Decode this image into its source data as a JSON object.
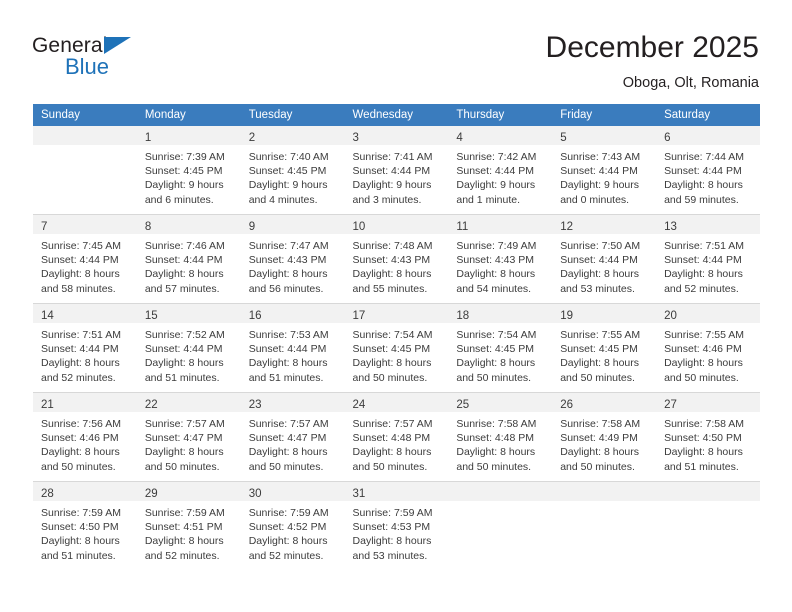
{
  "brand": {
    "name_top": "General",
    "name_bottom": "Blue",
    "accent_color": "#1e72b8"
  },
  "header": {
    "month_title": "December 2025",
    "location": "Oboga, Olt, Romania"
  },
  "calendar": {
    "header_color": "#3a7cbe",
    "datebar_color": "#f2f2f2",
    "weekday_headers": [
      "Sunday",
      "Monday",
      "Tuesday",
      "Wednesday",
      "Thursday",
      "Friday",
      "Saturday"
    ],
    "weeks": [
      [
        {
          "day": "",
          "sunrise": "",
          "sunset": "",
          "daylight_1": "",
          "daylight_2": ""
        },
        {
          "day": "1",
          "sunrise": "Sunrise: 7:39 AM",
          "sunset": "Sunset: 4:45 PM",
          "daylight_1": "Daylight: 9 hours",
          "daylight_2": "and 6 minutes."
        },
        {
          "day": "2",
          "sunrise": "Sunrise: 7:40 AM",
          "sunset": "Sunset: 4:45 PM",
          "daylight_1": "Daylight: 9 hours",
          "daylight_2": "and 4 minutes."
        },
        {
          "day": "3",
          "sunrise": "Sunrise: 7:41 AM",
          "sunset": "Sunset: 4:44 PM",
          "daylight_1": "Daylight: 9 hours",
          "daylight_2": "and 3 minutes."
        },
        {
          "day": "4",
          "sunrise": "Sunrise: 7:42 AM",
          "sunset": "Sunset: 4:44 PM",
          "daylight_1": "Daylight: 9 hours",
          "daylight_2": "and 1 minute."
        },
        {
          "day": "5",
          "sunrise": "Sunrise: 7:43 AM",
          "sunset": "Sunset: 4:44 PM",
          "daylight_1": "Daylight: 9 hours",
          "daylight_2": "and 0 minutes."
        },
        {
          "day": "6",
          "sunrise": "Sunrise: 7:44 AM",
          "sunset": "Sunset: 4:44 PM",
          "daylight_1": "Daylight: 8 hours",
          "daylight_2": "and 59 minutes."
        }
      ],
      [
        {
          "day": "7",
          "sunrise": "Sunrise: 7:45 AM",
          "sunset": "Sunset: 4:44 PM",
          "daylight_1": "Daylight: 8 hours",
          "daylight_2": "and 58 minutes."
        },
        {
          "day": "8",
          "sunrise": "Sunrise: 7:46 AM",
          "sunset": "Sunset: 4:44 PM",
          "daylight_1": "Daylight: 8 hours",
          "daylight_2": "and 57 minutes."
        },
        {
          "day": "9",
          "sunrise": "Sunrise: 7:47 AM",
          "sunset": "Sunset: 4:43 PM",
          "daylight_1": "Daylight: 8 hours",
          "daylight_2": "and 56 minutes."
        },
        {
          "day": "10",
          "sunrise": "Sunrise: 7:48 AM",
          "sunset": "Sunset: 4:43 PM",
          "daylight_1": "Daylight: 8 hours",
          "daylight_2": "and 55 minutes."
        },
        {
          "day": "11",
          "sunrise": "Sunrise: 7:49 AM",
          "sunset": "Sunset: 4:43 PM",
          "daylight_1": "Daylight: 8 hours",
          "daylight_2": "and 54 minutes."
        },
        {
          "day": "12",
          "sunrise": "Sunrise: 7:50 AM",
          "sunset": "Sunset: 4:44 PM",
          "daylight_1": "Daylight: 8 hours",
          "daylight_2": "and 53 minutes."
        },
        {
          "day": "13",
          "sunrise": "Sunrise: 7:51 AM",
          "sunset": "Sunset: 4:44 PM",
          "daylight_1": "Daylight: 8 hours",
          "daylight_2": "and 52 minutes."
        }
      ],
      [
        {
          "day": "14",
          "sunrise": "Sunrise: 7:51 AM",
          "sunset": "Sunset: 4:44 PM",
          "daylight_1": "Daylight: 8 hours",
          "daylight_2": "and 52 minutes."
        },
        {
          "day": "15",
          "sunrise": "Sunrise: 7:52 AM",
          "sunset": "Sunset: 4:44 PM",
          "daylight_1": "Daylight: 8 hours",
          "daylight_2": "and 51 minutes."
        },
        {
          "day": "16",
          "sunrise": "Sunrise: 7:53 AM",
          "sunset": "Sunset: 4:44 PM",
          "daylight_1": "Daylight: 8 hours",
          "daylight_2": "and 51 minutes."
        },
        {
          "day": "17",
          "sunrise": "Sunrise: 7:54 AM",
          "sunset": "Sunset: 4:45 PM",
          "daylight_1": "Daylight: 8 hours",
          "daylight_2": "and 50 minutes."
        },
        {
          "day": "18",
          "sunrise": "Sunrise: 7:54 AM",
          "sunset": "Sunset: 4:45 PM",
          "daylight_1": "Daylight: 8 hours",
          "daylight_2": "and 50 minutes."
        },
        {
          "day": "19",
          "sunrise": "Sunrise: 7:55 AM",
          "sunset": "Sunset: 4:45 PM",
          "daylight_1": "Daylight: 8 hours",
          "daylight_2": "and 50 minutes."
        },
        {
          "day": "20",
          "sunrise": "Sunrise: 7:55 AM",
          "sunset": "Sunset: 4:46 PM",
          "daylight_1": "Daylight: 8 hours",
          "daylight_2": "and 50 minutes."
        }
      ],
      [
        {
          "day": "21",
          "sunrise": "Sunrise: 7:56 AM",
          "sunset": "Sunset: 4:46 PM",
          "daylight_1": "Daylight: 8 hours",
          "daylight_2": "and 50 minutes."
        },
        {
          "day": "22",
          "sunrise": "Sunrise: 7:57 AM",
          "sunset": "Sunset: 4:47 PM",
          "daylight_1": "Daylight: 8 hours",
          "daylight_2": "and 50 minutes."
        },
        {
          "day": "23",
          "sunrise": "Sunrise: 7:57 AM",
          "sunset": "Sunset: 4:47 PM",
          "daylight_1": "Daylight: 8 hours",
          "daylight_2": "and 50 minutes."
        },
        {
          "day": "24",
          "sunrise": "Sunrise: 7:57 AM",
          "sunset": "Sunset: 4:48 PM",
          "daylight_1": "Daylight: 8 hours",
          "daylight_2": "and 50 minutes."
        },
        {
          "day": "25",
          "sunrise": "Sunrise: 7:58 AM",
          "sunset": "Sunset: 4:48 PM",
          "daylight_1": "Daylight: 8 hours",
          "daylight_2": "and 50 minutes."
        },
        {
          "day": "26",
          "sunrise": "Sunrise: 7:58 AM",
          "sunset": "Sunset: 4:49 PM",
          "daylight_1": "Daylight: 8 hours",
          "daylight_2": "and 50 minutes."
        },
        {
          "day": "27",
          "sunrise": "Sunrise: 7:58 AM",
          "sunset": "Sunset: 4:50 PM",
          "daylight_1": "Daylight: 8 hours",
          "daylight_2": "and 51 minutes."
        }
      ],
      [
        {
          "day": "28",
          "sunrise": "Sunrise: 7:59 AM",
          "sunset": "Sunset: 4:50 PM",
          "daylight_1": "Daylight: 8 hours",
          "daylight_2": "and 51 minutes."
        },
        {
          "day": "29",
          "sunrise": "Sunrise: 7:59 AM",
          "sunset": "Sunset: 4:51 PM",
          "daylight_1": "Daylight: 8 hours",
          "daylight_2": "and 52 minutes."
        },
        {
          "day": "30",
          "sunrise": "Sunrise: 7:59 AM",
          "sunset": "Sunset: 4:52 PM",
          "daylight_1": "Daylight: 8 hours",
          "daylight_2": "and 52 minutes."
        },
        {
          "day": "31",
          "sunrise": "Sunrise: 7:59 AM",
          "sunset": "Sunset: 4:53 PM",
          "daylight_1": "Daylight: 8 hours",
          "daylight_2": "and 53 minutes."
        },
        {
          "day": "",
          "sunrise": "",
          "sunset": "",
          "daylight_1": "",
          "daylight_2": ""
        },
        {
          "day": "",
          "sunrise": "",
          "sunset": "",
          "daylight_1": "",
          "daylight_2": ""
        },
        {
          "day": "",
          "sunrise": "",
          "sunset": "",
          "daylight_1": "",
          "daylight_2": ""
        }
      ]
    ]
  }
}
